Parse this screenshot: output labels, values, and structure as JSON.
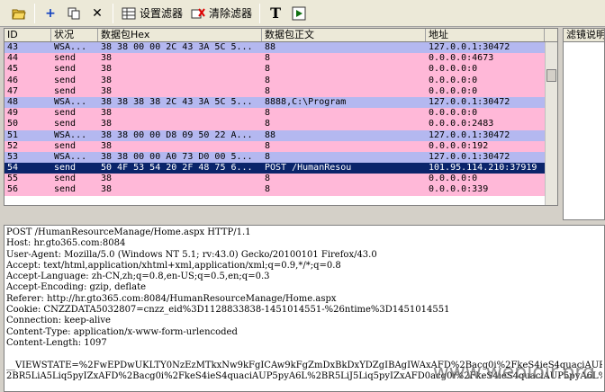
{
  "toolbar": {
    "set_filter_label": "设置滤器",
    "clear_filter_label": "清除滤器"
  },
  "table": {
    "headers": [
      "ID",
      "状况",
      "数据包Hex",
      "数据包正文",
      "地址"
    ],
    "rows": [
      {
        "id": "43",
        "status": "WSA...",
        "hex": "38 38 00 00 2C 43 3A 5C 5...",
        "text": "88",
        "addr": "127.0.0.1:30472",
        "style": "blue"
      },
      {
        "id": "44",
        "status": "send",
        "hex": "38",
        "text": "8",
        "addr": "0.0.0.0:4673",
        "style": "pink"
      },
      {
        "id": "45",
        "status": "send",
        "hex": "38",
        "text": "8",
        "addr": "0.0.0.0:0",
        "style": "pink"
      },
      {
        "id": "46",
        "status": "send",
        "hex": "38",
        "text": "8",
        "addr": "0.0.0.0:0",
        "style": "pink"
      },
      {
        "id": "47",
        "status": "send",
        "hex": "38",
        "text": "8",
        "addr": "0.0.0.0:0",
        "style": "pink"
      },
      {
        "id": "48",
        "status": "WSA...",
        "hex": "38 38 38 38 2C 43 3A 5C 5...",
        "text": "8888,C:\\Program",
        "addr": "127.0.0.1:30472",
        "style": "blue"
      },
      {
        "id": "49",
        "status": "send",
        "hex": "38",
        "text": "8",
        "addr": "0.0.0.0:0",
        "style": "pink"
      },
      {
        "id": "50",
        "status": "send",
        "hex": "38",
        "text": "8",
        "addr": "0.0.0.0:2483",
        "style": "pink"
      },
      {
        "id": "51",
        "status": "WSA...",
        "hex": "38 38 00 00 D8 09 50 22 A...",
        "text": "88",
        "addr": "127.0.0.1:30472",
        "style": "blue"
      },
      {
        "id": "52",
        "status": "send",
        "hex": "38",
        "text": "8",
        "addr": "0.0.0.0:192",
        "style": "pink"
      },
      {
        "id": "53",
        "status": "WSA...",
        "hex": "38 38 00 00 A0 73 D0 00 5...",
        "text": "8",
        "addr": "127.0.0.1:30472",
        "style": "blue"
      },
      {
        "id": "54",
        "status": "send",
        "hex": "50 4F 53 54 20 2F 48 75 6...",
        "text": "POST /HumanResou",
        "addr": "101.95.114.210:37919",
        "style": "sel"
      },
      {
        "id": "55",
        "status": "send",
        "hex": "38",
        "text": "8",
        "addr": "0.0.0.0:0",
        "style": "pink"
      },
      {
        "id": "56",
        "status": "send",
        "hex": "38",
        "text": "8",
        "addr": "0.0.0.0:339",
        "style": "pink"
      }
    ]
  },
  "filter_panel": {
    "header": "滤镜说明"
  },
  "detail": {
    "lines": [
      "POST /HumanResourceManage/Home.aspx HTTP/1.1",
      "Host: hr.gto365.com:8084",
      "User-Agent: Mozilla/5.0 (Windows NT 5.1; rv:43.0) Gecko/20100101 Firefox/43.0",
      "Accept: text/html,application/xhtml+xml,application/xml;q=0.9,*/*;q=0.8",
      "Accept-Language: zh-CN,zh;q=0.8,en-US;q=0.5,en;q=0.3",
      "Accept-Encoding: gzip, deflate",
      "Referer: http://hr.gto365.com:8084/HumanResourceManage/Home.aspx",
      "Cookie: CNZZDATA5032807=cnzz_eid%3D1128833838-1451014551-%26ntime%3D1451014551",
      "Connection: keep-alive",
      "Content-Type: application/x-www-form-urlencoded",
      "Content-Length: 1097",
      "",
      "__VIEWSTATE=%2FwEPDwUKLTY0NzEzMTkxNw9kFgICAw9kFgZmDxBkDxYDZgIBAgIWAxAFD%2Bacg0i%2FkeS4ieS4quaciAUP5pyA6L%",
      "2BR5LiA5Liq5pyIZxAFD%2Bacg0i%2FkeS4ieS4quaciAUP5pyA6L%2BR5LiJ5Liq5pyIZxAFD0acg0i%2FkeS4ieS4quaciAUP5pyA6L%"
    ],
    "watermark": "www.weblojr.org"
  }
}
